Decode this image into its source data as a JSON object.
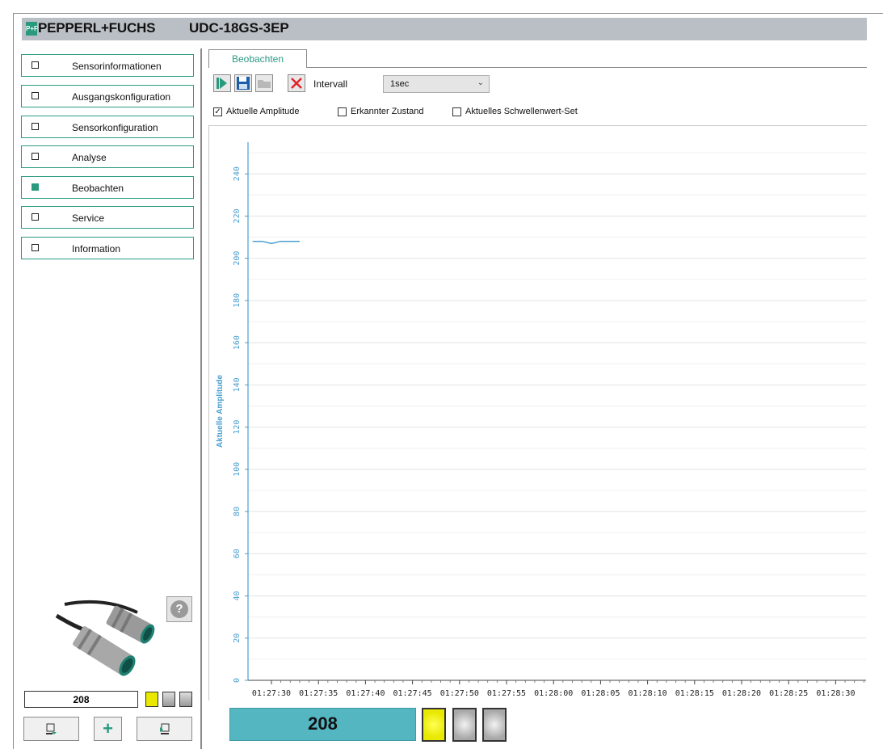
{
  "header": {
    "logo_text": "PEPPERL+FUCHS",
    "logo_mark": "P+F",
    "model": "UDC-18GS-3EP"
  },
  "sidebar": {
    "items": [
      {
        "label": "Sensorinformationen",
        "active": false
      },
      {
        "label": "Ausgangskonfiguration",
        "active": false
      },
      {
        "label": "Sensorkonfiguration",
        "active": false
      },
      {
        "label": "Analyse",
        "active": false
      },
      {
        "label": "Beobachten",
        "active": true
      },
      {
        "label": "Service",
        "active": false
      },
      {
        "label": "Information",
        "active": false
      }
    ],
    "current_value": "208",
    "help_icon": "question-icon"
  },
  "tabs": [
    {
      "label": "Beobachten"
    }
  ],
  "toolbar": {
    "intervall_label": "Intervall",
    "intervall_value": "1sec",
    "buttons": [
      "play-icon",
      "save-icon",
      "folder-icon",
      "clear-icon"
    ]
  },
  "checkboxes": [
    {
      "label": "Aktuelle Amplitude",
      "checked": true
    },
    {
      "label": "Erkannter Zustand",
      "checked": false
    },
    {
      "label": "Aktuelles Schwellenwert-Set",
      "checked": false
    }
  ],
  "status": {
    "value": "208",
    "indicators": [
      "yellow",
      "gray",
      "gray"
    ]
  },
  "colors": {
    "accent": "#2a9a84",
    "axis": "#4a9fd0",
    "value_panel": "#53b6c1",
    "header_bar": "#b9bfc4",
    "indicator_yellow": "#e8e800"
  },
  "chart_data": {
    "type": "line",
    "ylabel": "Aktuelle Amplitude",
    "ylim": [
      0,
      255
    ],
    "yticks": [
      0,
      20,
      40,
      60,
      80,
      100,
      120,
      140,
      160,
      180,
      200,
      220,
      240
    ],
    "xticks": [
      "01:27:30",
      "01:27:35",
      "01:27:40",
      "01:27:45",
      "01:27:50",
      "01:27:55",
      "01:28:00",
      "01:28:05",
      "01:28:10",
      "01:28:15",
      "01:28:20",
      "01:28:25",
      "01:28:30"
    ],
    "grid": true,
    "series": [
      {
        "values_x": [
          "01:27:28",
          "01:27:29",
          "01:27:30",
          "01:27:31",
          "01:27:32",
          "01:27:33"
        ],
        "values": [
          208,
          208,
          207,
          208,
          208,
          208
        ]
      }
    ]
  }
}
